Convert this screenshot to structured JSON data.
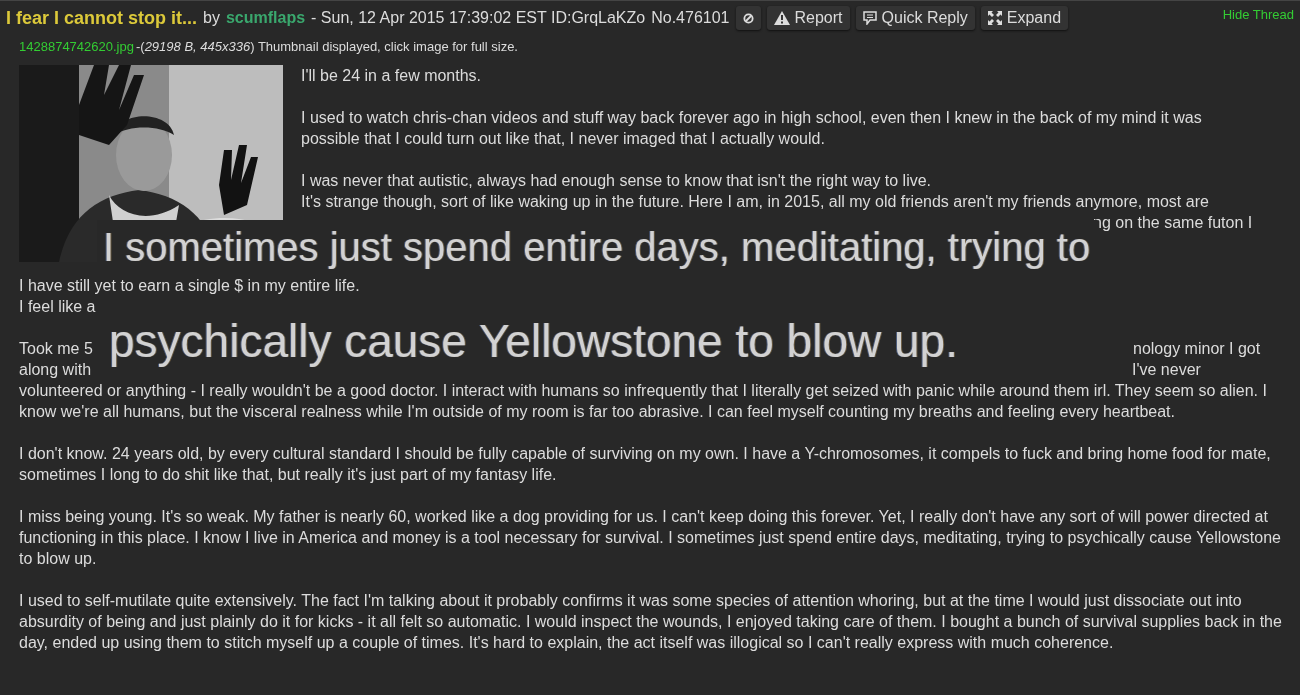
{
  "post": {
    "subject": "I fear I cannot stop it...",
    "by_label": "by",
    "author": "scumflaps",
    "meta": "- Sun, 12 Apr 2015 17:39:02 EST ID:GrqLaKZo",
    "number": "No.476101",
    "buttons": [
      {
        "kind": "ban"
      },
      {
        "kind": "report",
        "label": "Report"
      },
      {
        "kind": "reply",
        "label": "Quick Reply"
      },
      {
        "kind": "expand",
        "label": "Expand"
      }
    ],
    "hide_link": "Hide Thread"
  },
  "file": {
    "name": "1428874742620.jpg",
    "info": "-(*29198 B, 445x336*) Thumbnail displayed, click image for full size."
  },
  "beside_image": [
    {
      "lines": [
        {
          "left": "I'll be 24 in a few months."
        }
      ]
    },
    {
      "lines": [
        {
          "left": "I used to watch chris-chan videos and stuff way back forever ago in high school, even then I knew in the back of my mind it was"
        },
        {
          "left": "possible that I could turn out like that, I never imaged that I actually would."
        }
      ]
    },
    {
      "lines": [
        {
          "left": "I was never that autistic, always had enough sense to know that isn't the right way to live."
        },
        {
          "left": "It's strange though, sort of like waking up in the future. Here I am, in 2015, all my old friends aren't my friends anymore, most are"
        },
        {
          "right": "ng on the same futon I"
        }
      ]
    }
  ],
  "paragraphs": [
    {
      "lines": [
        {
          "left": "I have still yet to earn a single $ in my entire life."
        },
        {
          "left": "I feel like a"
        }
      ]
    },
    {
      "lines": [
        {
          "left": "Took me 5",
          "right": "nology minor I got"
        },
        {
          "left": "along with",
          "right": "I've never"
        }
      ],
      "text": "volunteered or anything - I really wouldn't be a good doctor. I interact with humans so infrequently that I literally get seized with panic while around them irl. They seem so alien. I know we're all humans, but the visceral realness while I'm outside of my room is far too abrasive. I can feel myself counting my breaths and feeling every heartbeat."
    },
    {
      "text": "I don't know. 24 years old, by every cultural standard I should be fully capable of surviving on my own. I have a Y-chromosomes, it compels to fuck and bring home food for mate, sometimes I long to do shit like that, but really it's just part of my fantasy life."
    },
    {
      "text": "I miss being young. It's so weak. My father is nearly 60, worked like a dog providing for us. I can't keep doing this forever. Yet, I really don't have any sort of will power directed at functioning in this place. I know I live in America and money is a tool necessary for survival. I sometimes just spend entire days, meditating, trying to psychically cause Yellowstone to blow up."
    },
    {
      "text": "I used to self-mutilate quite extensively. The fact I'm talking about it probably confirms it was some species of attention whoring, but at the time I would just dissociate out into absurdity of being and just plainly do it for kicks - it all felt so automatic. I would inspect the wounds, I enjoyed taking care of them. I bought a bunch of survival supplies back in the day, ended up using them to stitch myself up a couple of times. It's hard to explain, the act itself was illogical so I can't really express with much coherence."
    }
  ],
  "overlay_caption": [
    "I sometimes just spend entire days, meditating, trying to",
    "psychically cause Yellowstone to blow up."
  ]
}
